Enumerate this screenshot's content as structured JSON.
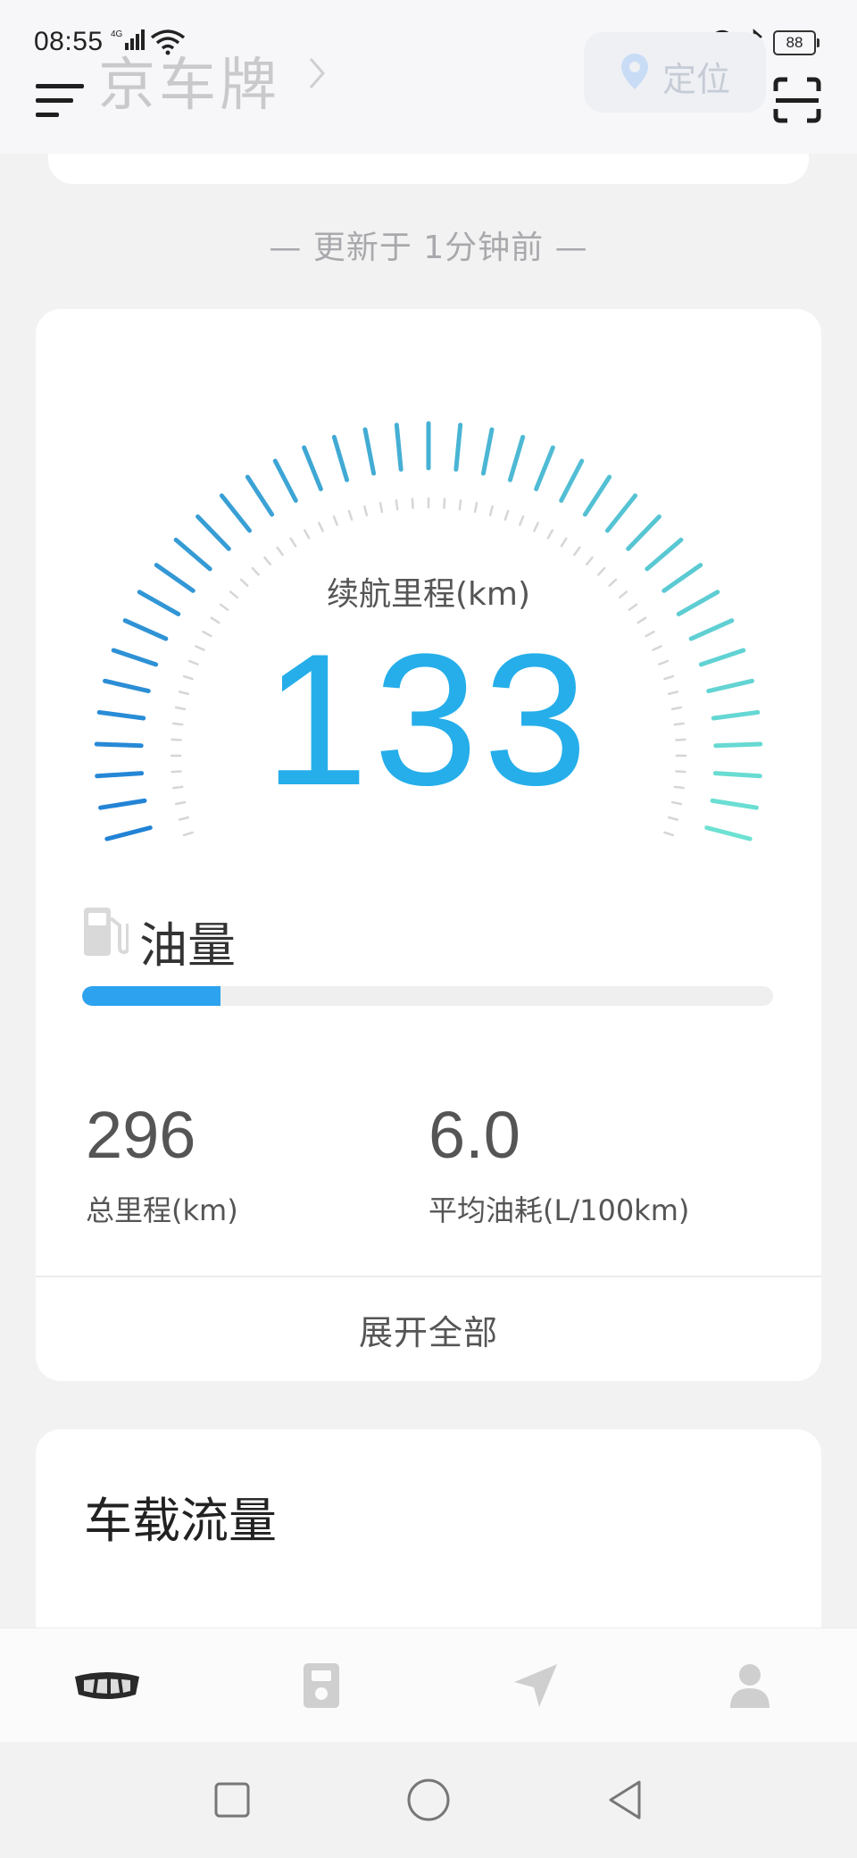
{
  "status_bar": {
    "time": "08:55",
    "network": "4G",
    "battery": "88"
  },
  "header": {
    "title": "京车牌",
    "locate_label": "定位"
  },
  "updated_text": "— 更新于 1分钟前 —",
  "range": {
    "label": "续航里程(km)",
    "value": "133"
  },
  "fuel": {
    "label": "油量",
    "level_percent": 20
  },
  "stats": {
    "total_mileage": {
      "value": "296",
      "label": "总里程(km)"
    },
    "avg_consumption": {
      "value": "6.0",
      "label": "平均油耗(L/100km)"
    }
  },
  "expand_label": "展开全部",
  "flow_card": {
    "title": "车载流量"
  },
  "tabs": [
    {
      "name": "car",
      "icon": "car-logo-icon",
      "active": true
    },
    {
      "name": "device",
      "icon": "device-icon",
      "active": false
    },
    {
      "name": "navigation",
      "icon": "navigation-arrow-icon",
      "active": false
    },
    {
      "name": "profile",
      "icon": "person-icon",
      "active": false
    }
  ],
  "colors": {
    "gauge_start": "#1f7fd6",
    "gauge_end": "#6fe3d2",
    "range_value": "#25aeea",
    "fuel_fill": "#2da2ee",
    "tab_inactive": "#cfcfcf",
    "tab_active": "#2a2a2a"
  }
}
